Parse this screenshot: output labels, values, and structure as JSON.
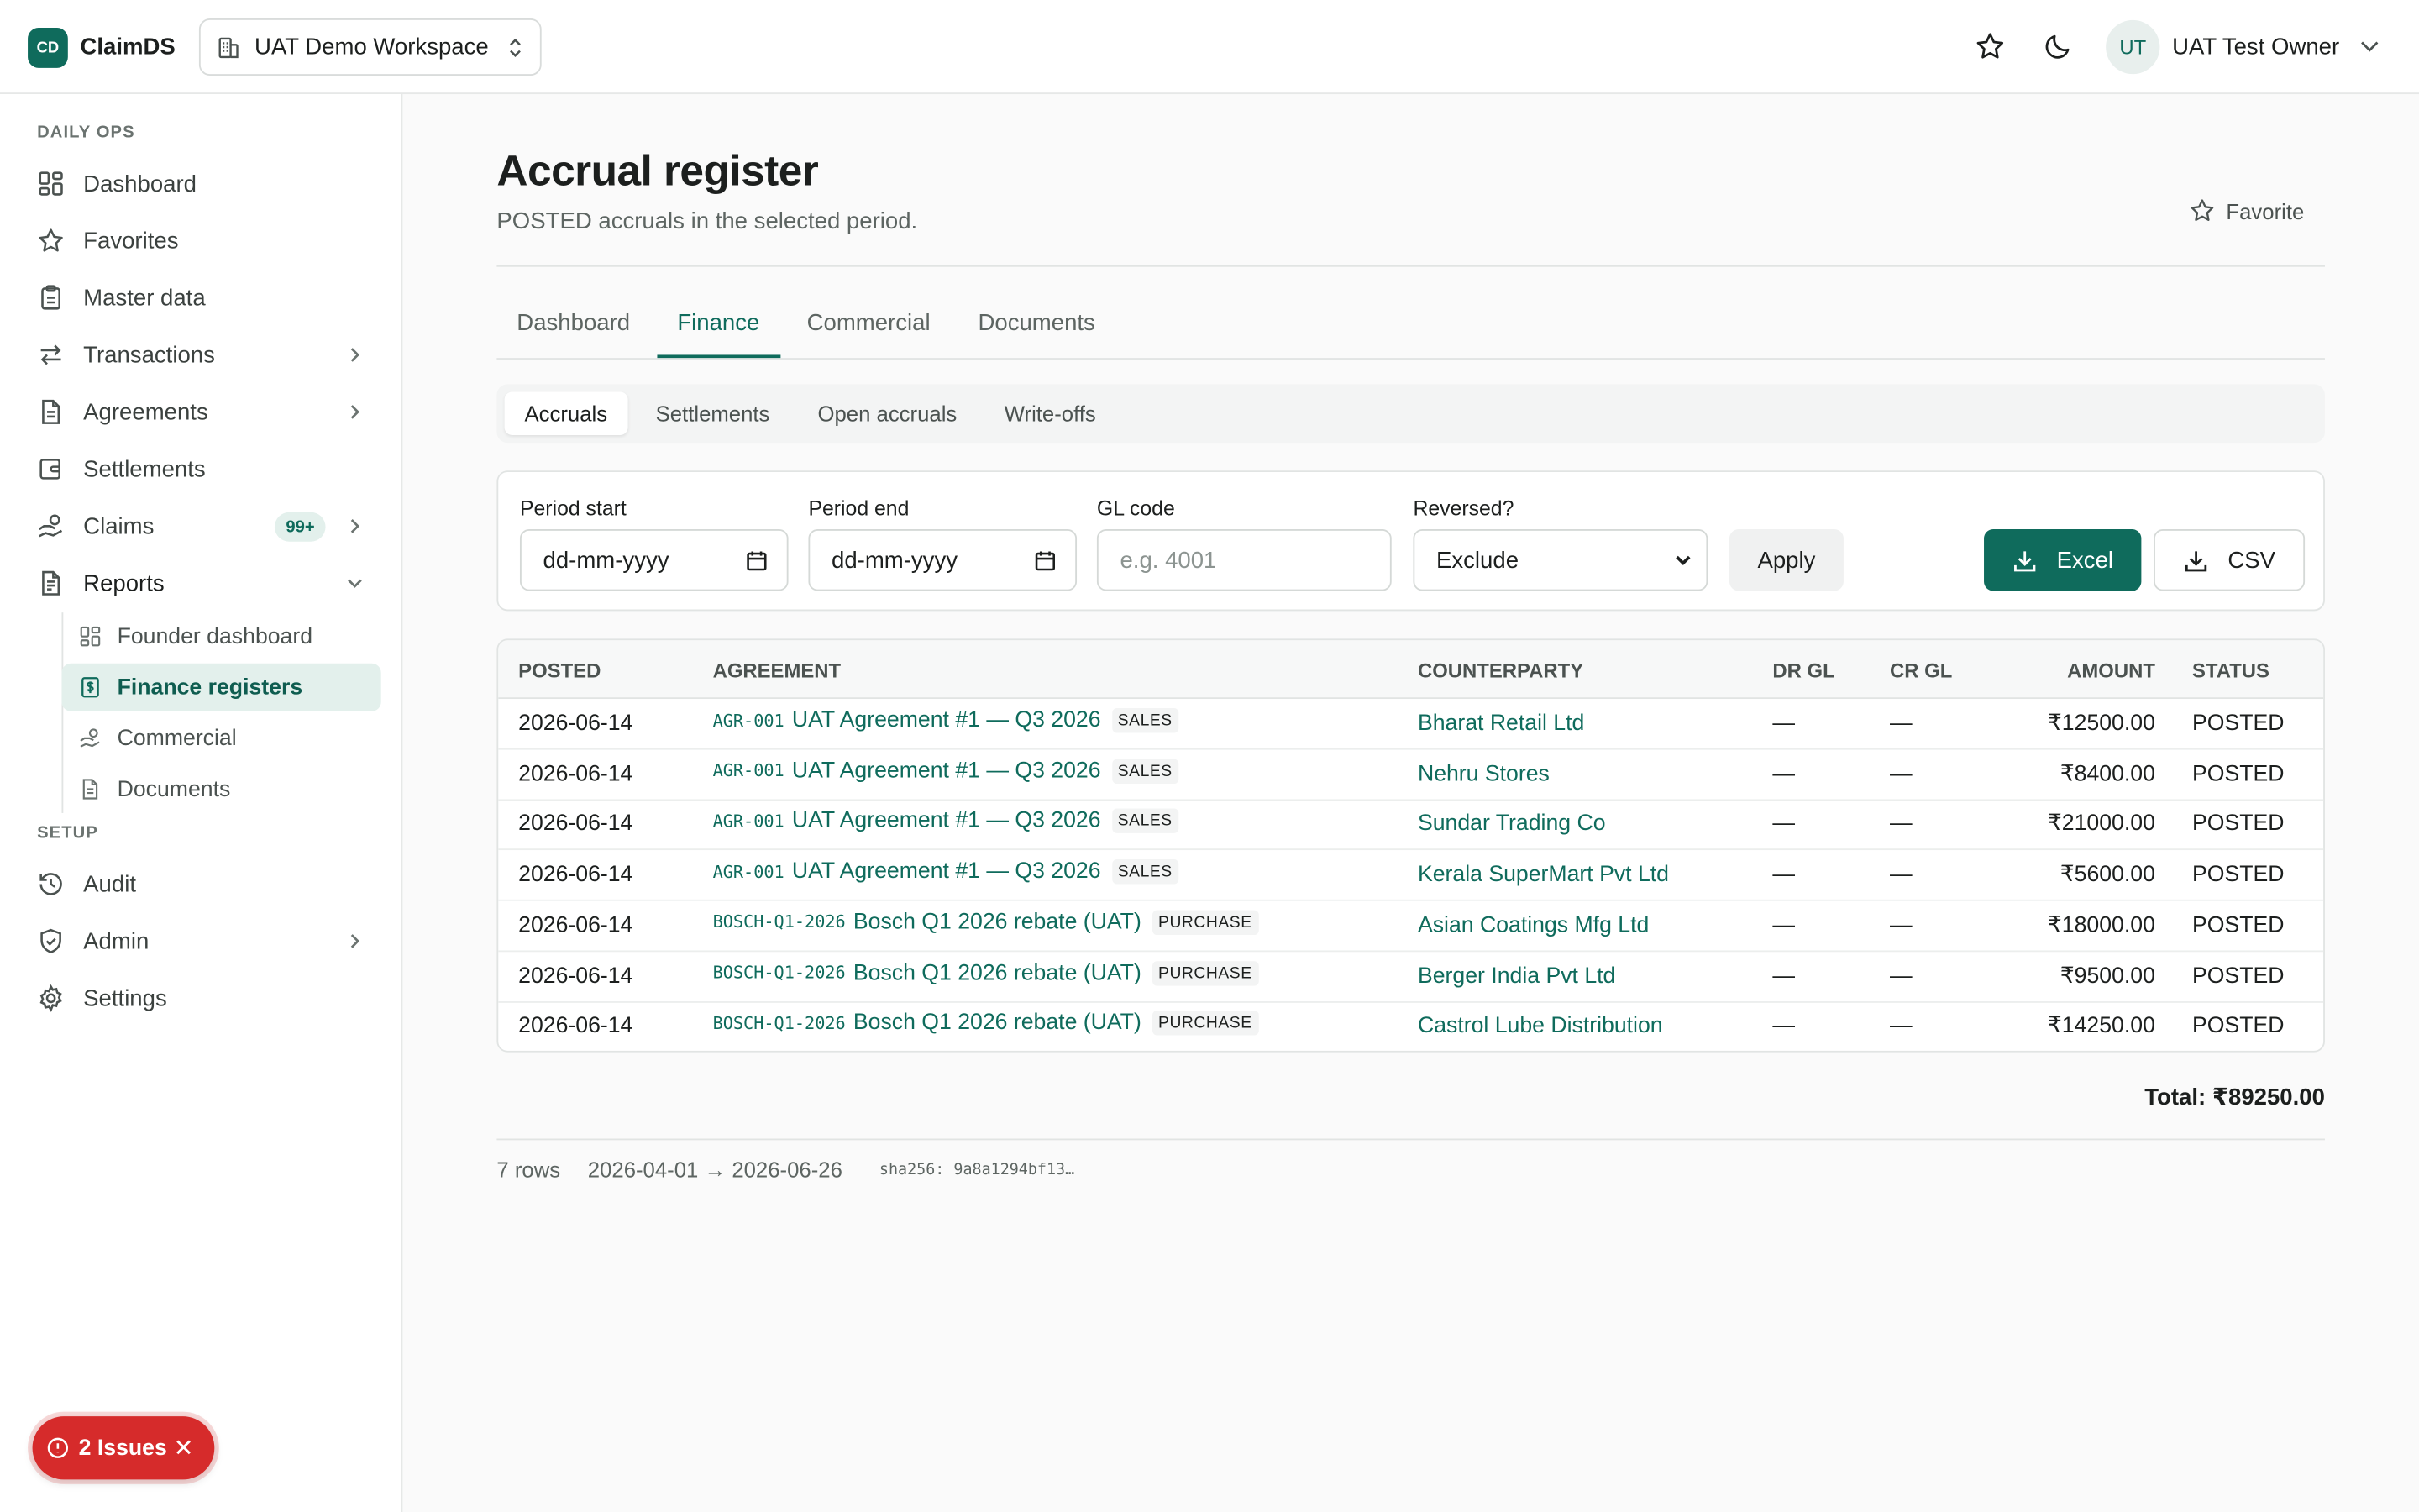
{
  "app": {
    "logo_text": "CD",
    "name": "ClaimDS",
    "workspace": "UAT Demo Workspace",
    "user_initials": "UT",
    "user_name": "UAT Test Owner",
    "brand_color": "#0f6b5c"
  },
  "sidebar": {
    "sections": [
      {
        "label": "DAILY OPS"
      },
      {
        "label": "SETUP"
      }
    ],
    "items": [
      {
        "label": "Dashboard",
        "icon": "dashboard-icon"
      },
      {
        "label": "Favorites",
        "icon": "star-icon"
      },
      {
        "label": "Master data",
        "icon": "clipboard-icon"
      },
      {
        "label": "Transactions",
        "icon": "arrows-icon",
        "has_children": true
      },
      {
        "label": "Agreements",
        "icon": "file-icon",
        "has_children": true
      },
      {
        "label": "Settlements",
        "icon": "wallet-icon"
      },
      {
        "label": "Claims",
        "icon": "hand-coins-icon",
        "badge": "99+",
        "has_children": true
      },
      {
        "label": "Reports",
        "icon": "report-icon",
        "expanded": true
      },
      {
        "label": "Audit",
        "icon": "history-icon"
      },
      {
        "label": "Admin",
        "icon": "shield-icon",
        "has_children": true
      },
      {
        "label": "Settings",
        "icon": "gear-icon"
      }
    ],
    "report_children": [
      {
        "label": "Founder dashboard",
        "icon": "dashboard-icon"
      },
      {
        "label": "Finance registers",
        "icon": "dollar-file-icon",
        "active": true
      },
      {
        "label": "Commercial",
        "icon": "hand-coins-icon"
      },
      {
        "label": "Documents",
        "icon": "file-icon"
      }
    ]
  },
  "page": {
    "title": "Accrual register",
    "subtitle": "POSTED accruals in the selected period.",
    "favorite_label": "Favorite"
  },
  "tabs": [
    {
      "label": "Dashboard"
    },
    {
      "label": "Finance",
      "active": true
    },
    {
      "label": "Commercial"
    },
    {
      "label": "Documents"
    }
  ],
  "subtabs": [
    {
      "label": "Accruals",
      "active": true
    },
    {
      "label": "Settlements"
    },
    {
      "label": "Open accruals"
    },
    {
      "label": "Write-offs"
    }
  ],
  "filters": {
    "period_start_label": "Period start",
    "period_start_value": "dd-mm-yyyy",
    "period_end_label": "Period end",
    "period_end_value": "dd-mm-yyyy",
    "gl_label": "GL code",
    "gl_placeholder": "e.g. 4001",
    "reversed_label": "Reversed?",
    "reversed_value": "Exclude",
    "apply_label": "Apply",
    "excel_label": "Excel",
    "csv_label": "CSV"
  },
  "table": {
    "columns": [
      "POSTED",
      "AGREEMENT",
      "COUNTERPARTY",
      "DR GL",
      "CR GL",
      "AMOUNT",
      "STATUS"
    ],
    "rows": [
      {
        "posted": "2026-06-14",
        "code": "AGR-001",
        "agreement": "UAT Agreement #1 — Q3 2026",
        "kind": "SALES",
        "counterparty": "Bharat Retail Ltd",
        "dr_gl": "—",
        "cr_gl": "—",
        "amount": "₹12500.00",
        "status": "POSTED"
      },
      {
        "posted": "2026-06-14",
        "code": "AGR-001",
        "agreement": "UAT Agreement #1 — Q3 2026",
        "kind": "SALES",
        "counterparty": "Nehru Stores",
        "dr_gl": "—",
        "cr_gl": "—",
        "amount": "₹8400.00",
        "status": "POSTED"
      },
      {
        "posted": "2026-06-14",
        "code": "AGR-001",
        "agreement": "UAT Agreement #1 — Q3 2026",
        "kind": "SALES",
        "counterparty": "Sundar Trading Co",
        "dr_gl": "—",
        "cr_gl": "—",
        "amount": "₹21000.00",
        "status": "POSTED"
      },
      {
        "posted": "2026-06-14",
        "code": "AGR-001",
        "agreement": "UAT Agreement #1 — Q3 2026",
        "kind": "SALES",
        "counterparty": "Kerala SuperMart Pvt Ltd",
        "dr_gl": "—",
        "cr_gl": "—",
        "amount": "₹5600.00",
        "status": "POSTED"
      },
      {
        "posted": "2026-06-14",
        "code": "BOSCH-Q1-2026",
        "agreement": "Bosch Q1 2026 rebate (UAT)",
        "kind": "PURCHASE",
        "counterparty": "Asian Coatings Mfg Ltd",
        "dr_gl": "—",
        "cr_gl": "—",
        "amount": "₹18000.00",
        "status": "POSTED"
      },
      {
        "posted": "2026-06-14",
        "code": "BOSCH-Q1-2026",
        "agreement": "Bosch Q1 2026 rebate (UAT)",
        "kind": "PURCHASE",
        "counterparty": "Berger India Pvt Ltd",
        "dr_gl": "—",
        "cr_gl": "—",
        "amount": "₹9500.00",
        "status": "POSTED"
      },
      {
        "posted": "2026-06-14",
        "code": "BOSCH-Q1-2026",
        "agreement": "Bosch Q1 2026 rebate (UAT)",
        "kind": "PURCHASE",
        "counterparty": "Castrol Lube Distribution",
        "dr_gl": "—",
        "cr_gl": "—",
        "amount": "₹14250.00",
        "status": "POSTED"
      }
    ],
    "total": "Total: ₹89250.00"
  },
  "footer": {
    "rows_count": "7 rows",
    "range": "2026-04-01 → 2026-06-26",
    "hash": "sha256: 9a8a1294bf13…"
  },
  "issues": {
    "label": "2 Issues",
    "color": "#d62b2b"
  }
}
